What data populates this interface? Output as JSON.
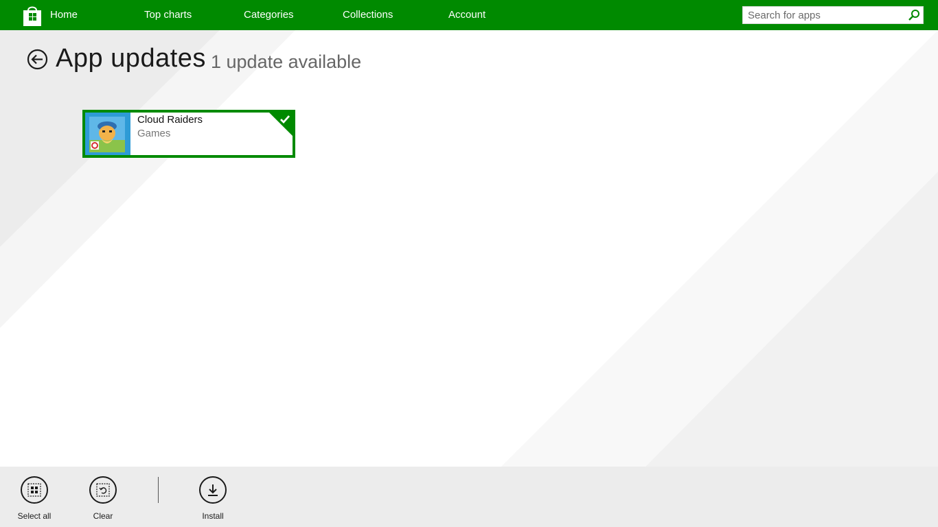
{
  "nav": {
    "items": [
      {
        "label": "Home"
      },
      {
        "label": "Top charts"
      },
      {
        "label": "Categories"
      },
      {
        "label": "Collections"
      },
      {
        "label": "Account"
      }
    ],
    "search_placeholder": "Search for apps"
  },
  "header": {
    "title": "App updates",
    "subtitle": "1 update available"
  },
  "updates": [
    {
      "name": "Cloud Raiders",
      "category": "Games",
      "selected": true
    }
  ],
  "appbar": {
    "select_all": "Select all",
    "clear": "Clear",
    "install": "Install"
  },
  "colors": {
    "accent": "#008a00",
    "app_icon_bg": "#2e9bd6",
    "appbar_bg": "#ececec"
  }
}
